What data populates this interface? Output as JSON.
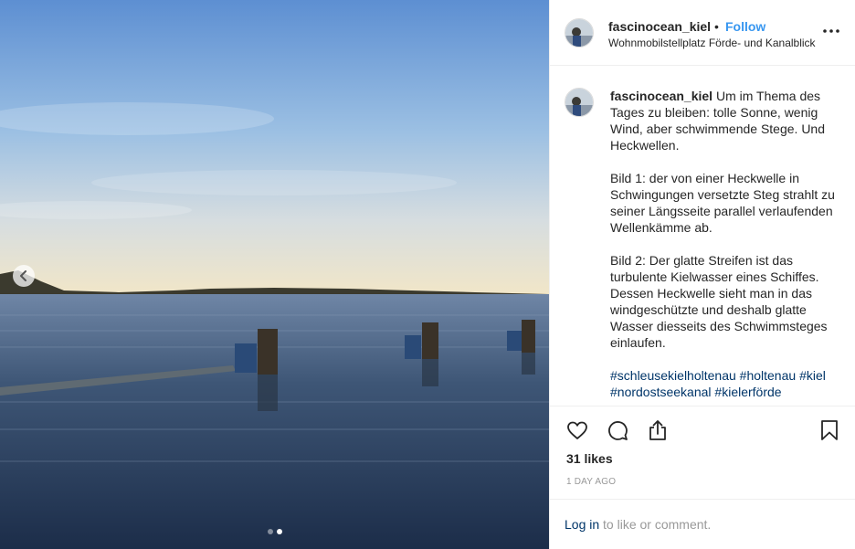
{
  "post": {
    "username": "fascinocean_kiel",
    "separator": "•",
    "follow_label": "Follow",
    "location": "Wohnmobilstellplatz Förde- und Kanalblick"
  },
  "caption": {
    "username": "fascinocean_kiel",
    "paragraphs": [
      "Um im Thema des Tages zu bleiben: tolle Sonne, wenig Wind, aber schwimmende Stege. Und Heckwellen.",
      "Bild 1: der von einer Heckwelle in Schwingungen versetzte Steg strahlt zu seiner Längsseite parallel verlaufenden Wellenkämme ab.",
      "Bild 2: Der glatte Streifen ist das turbulente Kielwasser eines Schiffes. Dessen Heckwelle sieht man in das windgeschützte und deshalb glatte Wasser diesseits des Schwimmsteges einlaufen."
    ],
    "hashtags": [
      "#schleusekielholtenau",
      "#holtenau",
      "#kiel",
      "#nordostseekanal",
      "#kielerförde"
    ]
  },
  "stats": {
    "likes": "31 likes",
    "time": "1 DAY AGO"
  },
  "footer": {
    "login_link": "Log in",
    "login_rest": " to like or comment."
  },
  "carousel": {
    "total": 2,
    "active": 2
  },
  "icons": {
    "prev": "chevron-left-icon",
    "more": "more-options-icon",
    "like": "heart-icon",
    "comment": "comment-icon",
    "share": "share-icon",
    "save": "bookmark-icon"
  },
  "colors": {
    "link_blue": "#3897f0",
    "hashtag": "#003569",
    "muted": "#999999",
    "text": "#262626"
  }
}
